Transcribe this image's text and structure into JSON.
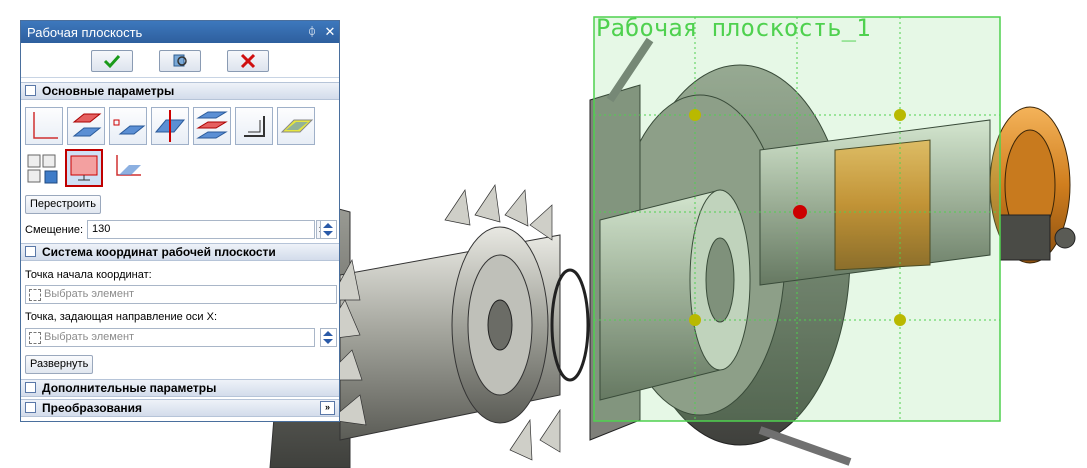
{
  "dialog": {
    "title": "Рабочая плоскость",
    "pin_glyph": "📌",
    "close_glyph": "✕",
    "ok_icon": "checkmark-icon",
    "preview_icon": "preview-icon",
    "cancel_icon": "cancel-icon"
  },
  "sections": {
    "main": "Основные параметры",
    "coords": "Система координат рабочей плоскости",
    "extra": "Дополнительные параметры",
    "transforms": "Преобразования"
  },
  "main": {
    "rebuild_button": "Перестроить",
    "offset_label": "Смещение:",
    "offset_value": "130"
  },
  "coords": {
    "origin_label": "Точка начала координат:",
    "origin_placeholder": "Выбрать элемент",
    "xaxis_label": "Точка, задающая направление оси X:",
    "xaxis_placeholder": "Выбрать элемент",
    "expand_button": "Развернуть"
  },
  "viewport": {
    "plane_name": "Рабочая плоскость_1",
    "plane_color": "#4fd14f",
    "highlight_color": "#c00000"
  }
}
